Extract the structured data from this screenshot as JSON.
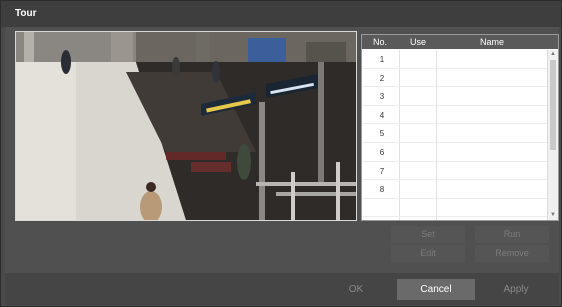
{
  "dialog": {
    "title": "Tour"
  },
  "table": {
    "headers": {
      "no": "No.",
      "use": "Use",
      "name": "Name"
    },
    "rows": [
      "1",
      "2",
      "3",
      "4",
      "5",
      "6",
      "7",
      "8"
    ]
  },
  "actions": {
    "set": "Set",
    "run": "Run",
    "edit": "Edit",
    "remove": "Remove"
  },
  "footer": {
    "ok": "OK",
    "cancel": "Cancel",
    "apply": "Apply"
  },
  "icons": {
    "scroll_up": "chevron-up-icon",
    "scroll_down": "chevron-down-icon"
  }
}
